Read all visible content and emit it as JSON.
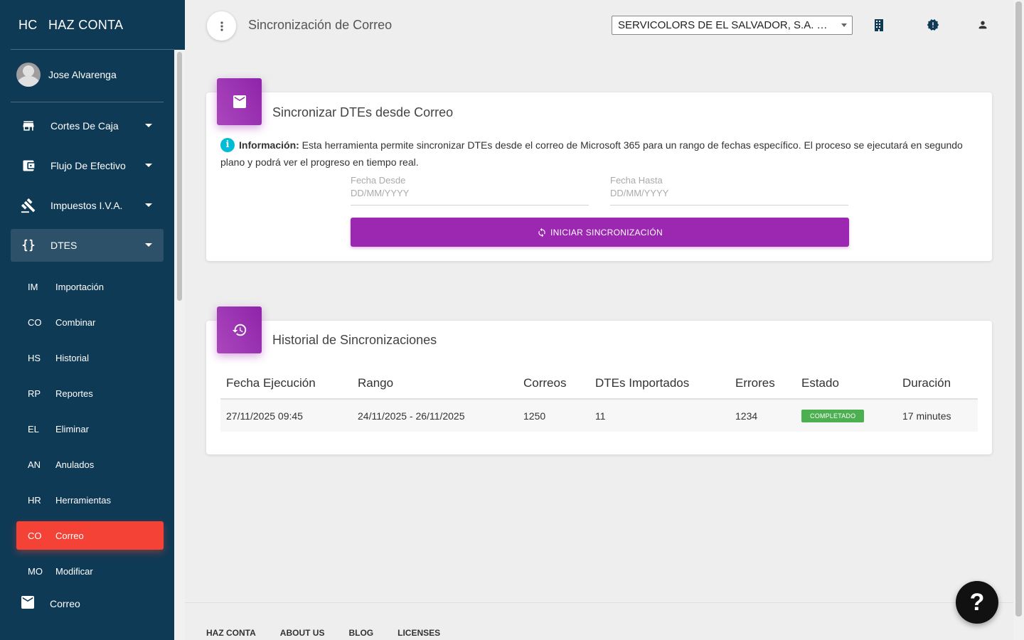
{
  "app": {
    "brand_mini": "HC",
    "brand_name": "HAZ CONTA"
  },
  "user": {
    "name": "Jose Alvarenga"
  },
  "sidebar": {
    "items": [
      {
        "label": "Cortes De Caja",
        "icon": "store-icon"
      },
      {
        "label": "Flujo De Efectivo",
        "icon": "wallet-icon"
      },
      {
        "label": "Impuestos I.V.A.",
        "icon": "gavel-icon"
      },
      {
        "label": "DTES",
        "icon": "code-braces-icon"
      }
    ],
    "subitems": [
      {
        "abbr": "IM",
        "label": "Importación"
      },
      {
        "abbr": "CO",
        "label": "Combinar"
      },
      {
        "abbr": "HS",
        "label": "Historial"
      },
      {
        "abbr": "RP",
        "label": "Reportes"
      },
      {
        "abbr": "EL",
        "label": "Eliminar"
      },
      {
        "abbr": "AN",
        "label": "Anulados"
      },
      {
        "abbr": "HR",
        "label": "Herramientas"
      },
      {
        "abbr": "CO",
        "label": "Correo"
      },
      {
        "abbr": "MO",
        "label": "Modificar"
      }
    ],
    "active_subitem": "Correo",
    "bottom_item": {
      "label": "Correo",
      "icon": "mail-icon"
    }
  },
  "header": {
    "title": "Sincronización de Correo",
    "company_select": "SERVICOLORS DE EL SALVADOR, S.A. DE C.V."
  },
  "sync_card": {
    "title": "Sincronizar DTEs desde Correo",
    "info_label": "Información:",
    "info_text": " Esta herramienta permite sincronizar DTEs desde el correo de Microsoft 365 para un rango de fechas específico. El proceso se ejecutará en segundo plano y podrá ver el progreso en tiempo real.",
    "fecha_desde_label": "Fecha Desde",
    "fecha_desde_placeholder": "DD/MM/YYYY",
    "fecha_hasta_label": "Fecha Hasta",
    "fecha_hasta_placeholder": "DD/MM/YYYY",
    "button_label": "INICIAR SINCRONIZACIÓN"
  },
  "history_card": {
    "title": "Historial de Sincronizaciones",
    "columns": [
      "Fecha Ejecución",
      "Rango",
      "Correos",
      "DTEs Importados",
      "Errores",
      "Estado",
      "Duración"
    ],
    "rows": [
      {
        "fecha": "27/11/2025 09:45",
        "rango": "24/11/2025 - 26/11/2025",
        "correos": "1250",
        "dtes": "11",
        "errores": "1234",
        "estado": "COMPLETADO",
        "duracion": "17 minutes"
      }
    ]
  },
  "footer": {
    "links": [
      "HAZ CONTA",
      "ABOUT US",
      "BLOG",
      "LICENSES"
    ]
  },
  "help": {
    "label": "?"
  },
  "colors": {
    "sidebar_bg": "#0f3a55",
    "accent_purple": "#9c27b0",
    "active_red": "#f44336",
    "status_green": "#4caf50",
    "info_cyan": "#00bcd4"
  }
}
